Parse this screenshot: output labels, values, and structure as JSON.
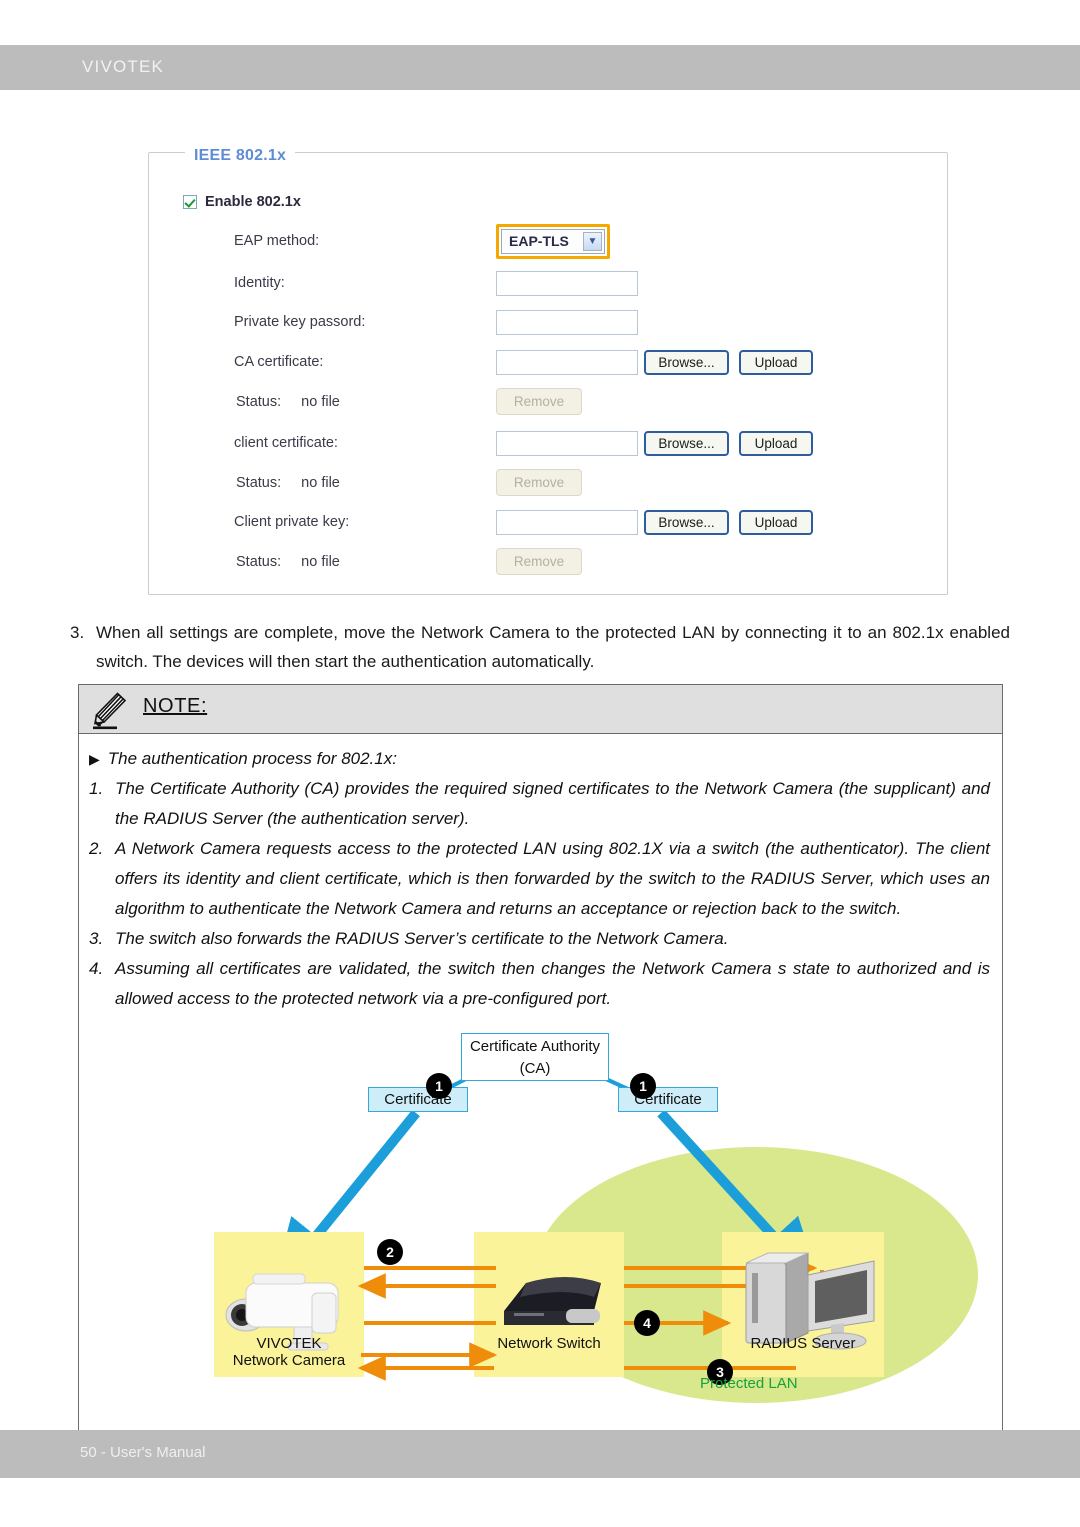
{
  "header": {
    "brand": "VIVOTEK"
  },
  "footer": {
    "text": "50 - User's Manual"
  },
  "settings_panel": {
    "legend": "IEEE 802.1x",
    "enable_checkbox_label": "Enable 802.1x",
    "fields": [
      {
        "label": "EAP method:",
        "type": "select",
        "value": "EAP-TLS",
        "highlighted": true
      },
      {
        "label": "Identity:",
        "type": "text",
        "value": ""
      },
      {
        "label": "Private key passord:",
        "type": "text",
        "value": ""
      },
      {
        "label": "CA certificate:",
        "type": "file",
        "value": "",
        "browse": "Browse...",
        "upload": "Upload"
      },
      {
        "label": "client certificate:",
        "type": "file",
        "value": "",
        "browse": "Browse...",
        "upload": "Upload"
      },
      {
        "label": "Client private key:",
        "type": "file",
        "value": "",
        "browse": "Browse...",
        "upload": "Upload"
      }
    ],
    "status_rows": [
      {
        "label": "Status:",
        "value": "no file",
        "button": "Remove"
      },
      {
        "label": "Status:",
        "value": "no file",
        "button": "Remove"
      },
      {
        "label": "Status:",
        "value": "no file",
        "button": "Remove"
      }
    ],
    "highlight_color": "#f5a800",
    "legend_color": "#5f8dd3"
  },
  "step": {
    "number": "3.",
    "text": "When all settings are complete, move the Network Camera to the protected LAN by connecting it to an 802.1x enabled switch. The devices will then start the authentication automatically."
  },
  "note": {
    "title": "NOTE:",
    "intro_marker": "▶",
    "intro": "The authentication process for 802.1x:",
    "items": [
      {
        "n": "1.",
        "text": "The Certificate Authority (CA) provides the required signed certificates to the Network Camera (the supplicant) and the RADIUS Server (the authentication server)."
      },
      {
        "n": "2.",
        "text": "A Network Camera requests access to the protected LAN using 802.1X via a switch (the authenticator). The client offers its identity and client certificate, which is then forwarded by the switch to the RADIUS Server, which uses an algorithm to authenticate the Network Camera and returns an acceptance or rejection back to the switch."
      },
      {
        "n": "3.",
        "text": "The switch also forwards the RADIUS Server’s certificate to the Network Camera."
      },
      {
        "n": "4.",
        "text": "Assuming all certificates are validated, the switch then changes the Network Camera s state to authorized and is allowed access to the protected network via a pre-configured port."
      }
    ]
  },
  "diagram": {
    "ca_line1": "Certificate Authority",
    "ca_line2": "(CA)",
    "cert_left": "Certificate",
    "cert_right": "Certificate",
    "badge_1a": "1",
    "badge_1b": "1",
    "badge_2": "2",
    "badge_3": "3",
    "badge_4": "4",
    "camera_line1": "VIVOTEK",
    "camera_line2": "Network Camera",
    "switch_label": "Network Switch",
    "server_label": "RADIUS Server",
    "protected_lan": "Protected LAN",
    "colors": {
      "blue_arrow": "#1b9ed9",
      "orange_arrow": "#ef8c0a",
      "node_fill": "#faf39a",
      "lan_fill": "#d9e88c",
      "lan_text": "#1aa03c",
      "cert_fill": "#cdeef8"
    }
  }
}
